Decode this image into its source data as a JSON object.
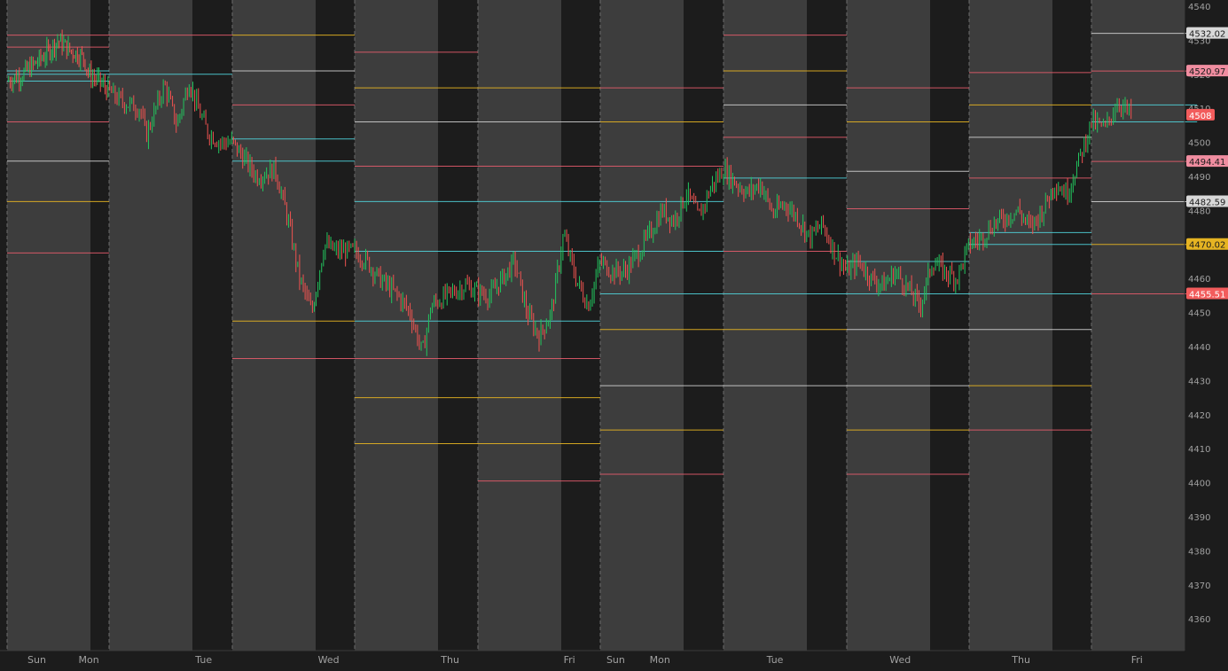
{
  "chart_data": {
    "type": "candlestick",
    "symbol_hint": "",
    "y_axis": {
      "min": 4355,
      "max": 4542,
      "ticks": [
        4540,
        4530,
        4520,
        4510,
        4500,
        4490,
        4480,
        4470,
        4460,
        4450,
        4440,
        4430,
        4420,
        4410,
        4400,
        4390,
        4380,
        4370,
        4360
      ]
    },
    "x_axis": {
      "labels": [
        {
          "label": "Sun",
          "t": 0.2
        },
        {
          "label": "Mon",
          "t": 0.7
        },
        {
          "label": "Tue",
          "t": 1.7
        },
        {
          "label": "Wed",
          "t": 2.7
        },
        {
          "label": "Thu",
          "t": 3.7
        },
        {
          "label": "Fri",
          "t": 4.7
        },
        {
          "label": "Sun",
          "t": 5.05
        },
        {
          "label": "Mon",
          "t": 5.4
        },
        {
          "label": "Tue",
          "t": 6.35
        },
        {
          "label": "Wed",
          "t": 7.35
        },
        {
          "label": "Thu",
          "t": 8.35
        },
        {
          "label": "Fri",
          "t": 9.3
        }
      ]
    },
    "sessions": [
      0,
      1,
      2,
      3,
      4,
      5,
      6,
      7,
      8,
      9
    ],
    "price_path": [
      [
        0.0,
        4518
      ],
      [
        0.15,
        4520
      ],
      [
        0.35,
        4525
      ],
      [
        0.5,
        4530
      ],
      [
        0.62,
        4527
      ],
      [
        0.75,
        4525
      ],
      [
        0.8,
        4520
      ],
      [
        0.9,
        4518
      ],
      [
        1.0,
        4515
      ],
      [
        1.1,
        4512
      ],
      [
        1.25,
        4510
      ],
      [
        1.3,
        4502
      ],
      [
        1.45,
        4517
      ],
      [
        1.55,
        4505
      ],
      [
        1.65,
        4518
      ],
      [
        1.72,
        4510
      ],
      [
        1.8,
        4503
      ],
      [
        1.9,
        4500
      ],
      [
        2.0,
        4500
      ],
      [
        2.1,
        4495
      ],
      [
        2.2,
        4490
      ],
      [
        2.35,
        4492
      ],
      [
        2.45,
        4478
      ],
      [
        2.55,
        4460
      ],
      [
        2.65,
        4450
      ],
      [
        2.75,
        4470
      ],
      [
        2.85,
        4468
      ],
      [
        3.0,
        4468
      ],
      [
        3.1,
        4465
      ],
      [
        3.2,
        4460
      ],
      [
        3.35,
        4455
      ],
      [
        3.45,
        4450
      ],
      [
        3.55,
        4438
      ],
      [
        3.62,
        4452
      ],
      [
        3.75,
        4455
      ],
      [
        3.9,
        4458
      ],
      [
        4.0,
        4456
      ],
      [
        4.1,
        4455
      ],
      [
        4.2,
        4460
      ],
      [
        4.3,
        4465
      ],
      [
        4.4,
        4450
      ],
      [
        4.5,
        4443
      ],
      [
        4.6,
        4450
      ],
      [
        4.7,
        4473
      ],
      [
        4.8,
        4460
      ],
      [
        4.9,
        4452
      ],
      [
        5.0,
        4465
      ],
      [
        5.1,
        4462
      ],
      [
        5.2,
        4462
      ],
      [
        5.3,
        4467
      ],
      [
        5.4,
        4473
      ],
      [
        5.5,
        4480
      ],
      [
        5.6,
        4477
      ],
      [
        5.7,
        4485
      ],
      [
        5.8,
        4478
      ],
      [
        5.9,
        4487
      ],
      [
        6.0,
        4492
      ],
      [
        6.1,
        4488
      ],
      [
        6.2,
        4485
      ],
      [
        6.3,
        4488
      ],
      [
        6.4,
        4479
      ],
      [
        6.5,
        4482
      ],
      [
        6.6,
        4478
      ],
      [
        6.7,
        4472
      ],
      [
        6.8,
        4476
      ],
      [
        6.9,
        4468
      ],
      [
        7.0,
        4462
      ],
      [
        7.1,
        4465
      ],
      [
        7.2,
        4460
      ],
      [
        7.3,
        4458
      ],
      [
        7.4,
        4462
      ],
      [
        7.5,
        4457
      ],
      [
        7.6,
        4452
      ],
      [
        7.7,
        4465
      ],
      [
        7.8,
        4462
      ],
      [
        7.9,
        4460
      ],
      [
        8.0,
        4470
      ],
      [
        8.1,
        4472
      ],
      [
        8.2,
        4476
      ],
      [
        8.3,
        4478
      ],
      [
        8.4,
        4480
      ],
      [
        8.5,
        4475
      ],
      [
        8.6,
        4480
      ],
      [
        8.7,
        4488
      ],
      [
        8.8,
        4485
      ],
      [
        8.9,
        4495
      ],
      [
        9.0,
        4506
      ],
      [
        9.1,
        4504
      ],
      [
        9.2,
        4512
      ],
      [
        9.3,
        4508
      ]
    ],
    "levels": [
      {
        "from": 0.0,
        "to": 1.0,
        "value": 4528.0,
        "color": "#e35b6b"
      },
      {
        "from": 0.0,
        "to": 1.0,
        "value": 4521.0,
        "color": "#4fd1d9"
      },
      {
        "from": 0.0,
        "to": 1.0,
        "value": 4520.0,
        "color": "#4fd1d9"
      },
      {
        "from": 0.0,
        "to": 1.0,
        "value": 4518.0,
        "color": "#4fd1d9"
      },
      {
        "from": 0.0,
        "to": 1.0,
        "value": 4506.0,
        "color": "#e35b6b"
      },
      {
        "from": 0.0,
        "to": 1.0,
        "value": 4494.5,
        "color": "#cfcfcf"
      },
      {
        "from": 0.0,
        "to": 1.0,
        "value": 4482.6,
        "color": "#e6b422"
      },
      {
        "from": 0.0,
        "to": 1.0,
        "value": 4467.5,
        "color": "#e35b6b"
      },
      {
        "from": 0.0,
        "to": 1.0,
        "value": 4531.5,
        "color": "#e35b6b"
      },
      {
        "from": 1.0,
        "to": 2.0,
        "value": 4531.5,
        "color": "#e35b6b"
      },
      {
        "from": 1.0,
        "to": 2.0,
        "value": 4520.0,
        "color": "#4fd1d9"
      },
      {
        "from": 2.0,
        "to": 3.0,
        "value": 4531.5,
        "color": "#e6b422"
      },
      {
        "from": 2.0,
        "to": 3.0,
        "value": 4521.0,
        "color": "#cfcfcf"
      },
      {
        "from": 2.0,
        "to": 3.0,
        "value": 4511.0,
        "color": "#e35b6b"
      },
      {
        "from": 2.0,
        "to": 3.0,
        "value": 4501.0,
        "color": "#4fd1d9"
      },
      {
        "from": 2.0,
        "to": 3.0,
        "value": 4494.5,
        "color": "#4fd1d9"
      },
      {
        "from": 2.0,
        "to": 3.0,
        "value": 4447.5,
        "color": "#e6b422"
      },
      {
        "from": 2.0,
        "to": 3.0,
        "value": 4436.5,
        "color": "#e35b6b"
      },
      {
        "from": 3.0,
        "to": 4.0,
        "value": 4526.5,
        "color": "#e35b6b"
      },
      {
        "from": 3.0,
        "to": 5.0,
        "value": 4516.0,
        "color": "#e6b422"
      },
      {
        "from": 3.0,
        "to": 5.0,
        "value": 4506.0,
        "color": "#cfcfcf"
      },
      {
        "from": 3.0,
        "to": 6.0,
        "value": 4493.0,
        "color": "#e35b6b"
      },
      {
        "from": 3.0,
        "to": 6.0,
        "value": 4482.6,
        "color": "#4fd1d9"
      },
      {
        "from": 3.0,
        "to": 6.0,
        "value": 4468.0,
        "color": "#4fd1d9"
      },
      {
        "from": 3.0,
        "to": 5.0,
        "value": 4447.5,
        "color": "#4fd1d9"
      },
      {
        "from": 3.0,
        "to": 5.0,
        "value": 4436.5,
        "color": "#e35b6b"
      },
      {
        "from": 3.0,
        "to": 5.0,
        "value": 4425.0,
        "color": "#e6b422"
      },
      {
        "from": 3.0,
        "to": 5.0,
        "value": 4411.5,
        "color": "#e6b422"
      },
      {
        "from": 4.0,
        "to": 5.0,
        "value": 4400.5,
        "color": "#e35b6b"
      },
      {
        "from": 5.0,
        "to": 6.0,
        "value": 4516.0,
        "color": "#e35b6b"
      },
      {
        "from": 5.0,
        "to": 6.0,
        "value": 4506.0,
        "color": "#e6b422"
      },
      {
        "from": 5.0,
        "to": 7.0,
        "value": 4455.5,
        "color": "#4fd1d9"
      },
      {
        "from": 5.0,
        "to": 7.0,
        "value": 4445.0,
        "color": "#e6b422"
      },
      {
        "from": 5.0,
        "to": 8.0,
        "value": 4428.5,
        "color": "#cfcfcf"
      },
      {
        "from": 5.0,
        "to": 6.0,
        "value": 4415.5,
        "color": "#e6b422"
      },
      {
        "from": 5.0,
        "to": 6.0,
        "value": 4402.5,
        "color": "#e35b6b"
      },
      {
        "from": 6.0,
        "to": 7.0,
        "value": 4531.5,
        "color": "#e35b6b"
      },
      {
        "from": 6.0,
        "to": 7.0,
        "value": 4521.0,
        "color": "#e6b422"
      },
      {
        "from": 6.0,
        "to": 7.0,
        "value": 4511.0,
        "color": "#cfcfcf"
      },
      {
        "from": 6.0,
        "to": 7.0,
        "value": 4501.5,
        "color": "#e35b6b"
      },
      {
        "from": 6.0,
        "to": 7.0,
        "value": 4489.5,
        "color": "#4fd1d9"
      },
      {
        "from": 6.0,
        "to": 7.0,
        "value": 4468.0,
        "color": "#e35b6b"
      },
      {
        "from": 7.0,
        "to": 8.0,
        "value": 4516.0,
        "color": "#e35b6b"
      },
      {
        "from": 7.0,
        "to": 8.0,
        "value": 4506.0,
        "color": "#e6b422"
      },
      {
        "from": 7.0,
        "to": 8.0,
        "value": 4491.5,
        "color": "#cfcfcf"
      },
      {
        "from": 7.0,
        "to": 8.0,
        "value": 4480.5,
        "color": "#e35b6b"
      },
      {
        "from": 7.0,
        "to": 8.0,
        "value": 4465.0,
        "color": "#4fd1d9"
      },
      {
        "from": 7.0,
        "to": 9.0,
        "value": 4455.5,
        "color": "#4fd1d9"
      },
      {
        "from": 7.0,
        "to": 9.0,
        "value": 4445.0,
        "color": "#cfcfcf"
      },
      {
        "from": 7.0,
        "to": 8.0,
        "value": 4415.5,
        "color": "#e6b422"
      },
      {
        "from": 7.0,
        "to": 8.0,
        "value": 4402.5,
        "color": "#e35b6b"
      },
      {
        "from": 8.0,
        "to": 9.0,
        "value": 4520.5,
        "color": "#e35b6b"
      },
      {
        "from": 8.0,
        "to": 9.0,
        "value": 4511.0,
        "color": "#e6b422"
      },
      {
        "from": 8.0,
        "to": 9.0,
        "value": 4501.5,
        "color": "#cfcfcf"
      },
      {
        "from": 8.0,
        "to": 9.0,
        "value": 4489.5,
        "color": "#e35b6b"
      },
      {
        "from": 8.0,
        "to": 9.0,
        "value": 4473.5,
        "color": "#4fd1d9"
      },
      {
        "from": 8.0,
        "to": 9.0,
        "value": 4470.0,
        "color": "#4fd1d9"
      },
      {
        "from": 8.0,
        "to": 9.0,
        "value": 4428.5,
        "color": "#e6b422"
      },
      {
        "from": 8.0,
        "to": 9.0,
        "value": 4415.5,
        "color": "#e35b6b"
      },
      {
        "from": 9.0,
        "to": 9.8,
        "value": 4532.02,
        "color": "#cfcfcf"
      },
      {
        "from": 9.0,
        "to": 9.8,
        "value": 4520.97,
        "color": "#e35b6b"
      },
      {
        "from": 9.0,
        "to": 9.8,
        "value": 4511.0,
        "color": "#4fd1d9"
      },
      {
        "from": 9.0,
        "to": 9.8,
        "value": 4506.0,
        "color": "#4fd1d9"
      },
      {
        "from": 9.0,
        "to": 9.8,
        "value": 4494.41,
        "color": "#e35b6b"
      },
      {
        "from": 9.0,
        "to": 9.8,
        "value": 4482.59,
        "color": "#cfcfcf"
      },
      {
        "from": 9.0,
        "to": 9.8,
        "value": 4470.02,
        "color": "#e6b422"
      },
      {
        "from": 9.0,
        "to": 9.8,
        "value": 4455.51,
        "color": "#e35b6b"
      }
    ],
    "price_tags": [
      {
        "label": "4532.02",
        "value": 4532.02,
        "bg": "#d8d8d8",
        "fg": "#1c1c1c"
      },
      {
        "label": "4520.97",
        "value": 4520.97,
        "bg": "#f08da0",
        "fg": "#1c1c1c"
      },
      {
        "label": "4508",
        "value": 4508,
        "bg": "#f25c5c",
        "fg": "#ffffff"
      },
      {
        "label": "4494.41",
        "value": 4494.41,
        "bg": "#f08da0",
        "fg": "#1c1c1c"
      },
      {
        "label": "4482.59",
        "value": 4482.59,
        "bg": "#d8d8d8",
        "fg": "#1c1c1c"
      },
      {
        "label": "4470.02",
        "value": 4470.02,
        "bg": "#e6b422",
        "fg": "#1c1c1c"
      },
      {
        "label": "4455.51",
        "value": 4455.51,
        "bg": "#f25c5c",
        "fg": "#ffffff"
      }
    ],
    "colors": {
      "background": "#1c1c1c",
      "session_band": "#3d3d3d",
      "up": "#22c55e",
      "down": "#ef5350",
      "axis_text": "#a0a0a0",
      "separator": "#6a6a6a"
    },
    "grid": false
  }
}
